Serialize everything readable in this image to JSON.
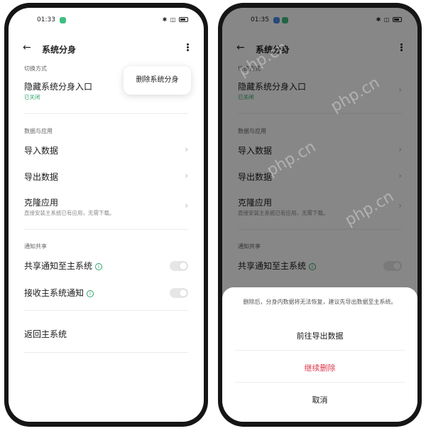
{
  "status_left": {
    "time": "01:33"
  },
  "status_right": {
    "time": "01:35"
  },
  "header": {
    "title": "系统分身"
  },
  "sections": {
    "switch_mode": "切换方式",
    "data_apps": "数据与应用",
    "notify_share": "通知共享"
  },
  "items": {
    "hide_entry": {
      "title": "隐藏系统分身入口",
      "status": "已关闭"
    },
    "import_data": "导入数据",
    "export_data": "导出数据",
    "clone_app": {
      "title": "克隆应用",
      "subtitle": "直接安装主系统已有应用，无需下载。"
    },
    "share_notify": "共享通知至主系统",
    "receive_notify": "接收主系统通知",
    "return_main": "返回主系统"
  },
  "menu": {
    "delete": "删除系统分身"
  },
  "sheet": {
    "message": "删除后，分身内数据将无法恢复，建议先导出数据至主系统。",
    "go_export": "前往导出数据",
    "continue_delete": "继续删除",
    "cancel": "取消"
  },
  "watermark": "php.cn",
  "colors": {
    "accent_green": "#2ea36b",
    "danger_red": "#e0384a"
  }
}
